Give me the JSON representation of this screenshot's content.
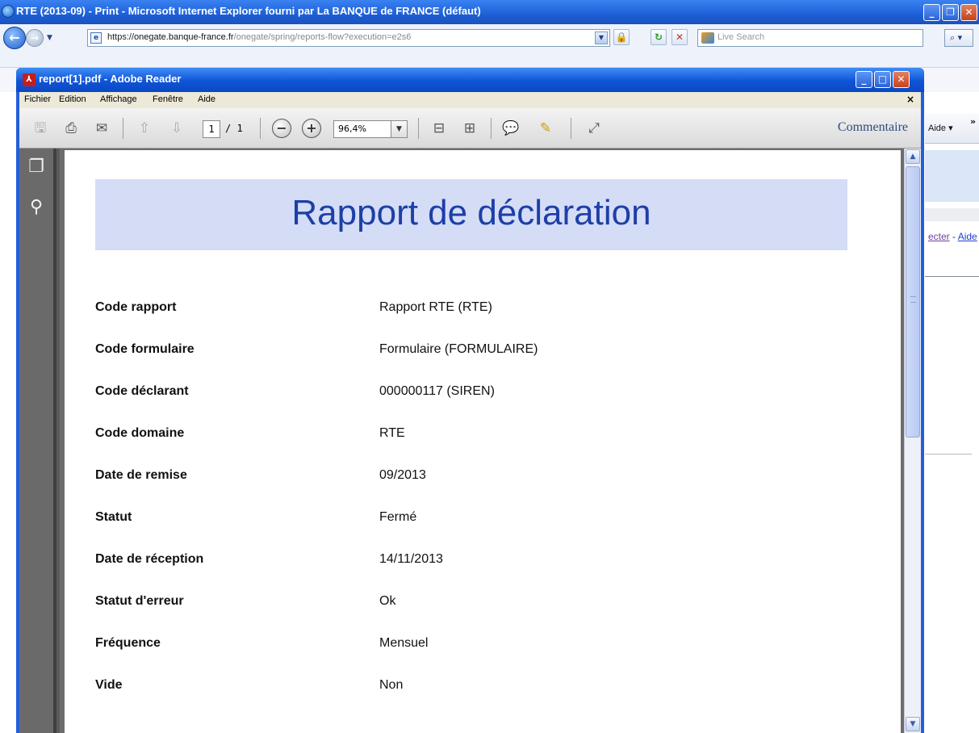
{
  "ie": {
    "title": "RTE (2013-09) - Print - Microsoft Internet Explorer fourni par La BANQUE de FRANCE (défaut)",
    "url_prefix": "https://",
    "url_domain": "onegate.banque-france.fr",
    "url_path": "/onegate/spring/reports-flow?execution=e2s6",
    "search_placeholder": "Live Search",
    "toolbar_aide": "Aide",
    "toolbar_more": "»",
    "link_disconnect": "ecter",
    "link_separator": " - ",
    "link_help": "Aide"
  },
  "reader": {
    "title": "report[1].pdf - Adobe Reader",
    "menu": {
      "fichier": "Fichier",
      "edition": "Edition",
      "affichage": "Affichage",
      "fenetre": "Fenêtre",
      "aide": "Aide",
      "close": "×"
    },
    "toolbar": {
      "page_current": "1",
      "page_total": "/ 1",
      "zoom": "96,4%",
      "commentaire": "Commentaire"
    }
  },
  "document": {
    "title": "Rapport de déclaration",
    "rows": [
      {
        "label": "Code rapport",
        "value": "Rapport RTE (RTE)"
      },
      {
        "label": "Code formulaire",
        "value": "Formulaire (FORMULAIRE)"
      },
      {
        "label": "Code déclarant",
        "value": "000000117 (SIREN)"
      },
      {
        "label": "Code domaine",
        "value": "RTE"
      },
      {
        "label": "Date de remise",
        "value": "09/2013"
      },
      {
        "label": "Statut",
        "value": "Fermé"
      },
      {
        "label": "Date de réception",
        "value": "14/11/2013"
      },
      {
        "label": "Statut d'erreur",
        "value": "Ok"
      },
      {
        "label": "Fréquence",
        "value": "Mensuel"
      },
      {
        "label": "Vide",
        "value": "Non"
      }
    ]
  },
  "colors": {
    "title_blue": "#1d3fa6",
    "header_band": "#d4dcf6",
    "xp_blue": "#245edb"
  }
}
